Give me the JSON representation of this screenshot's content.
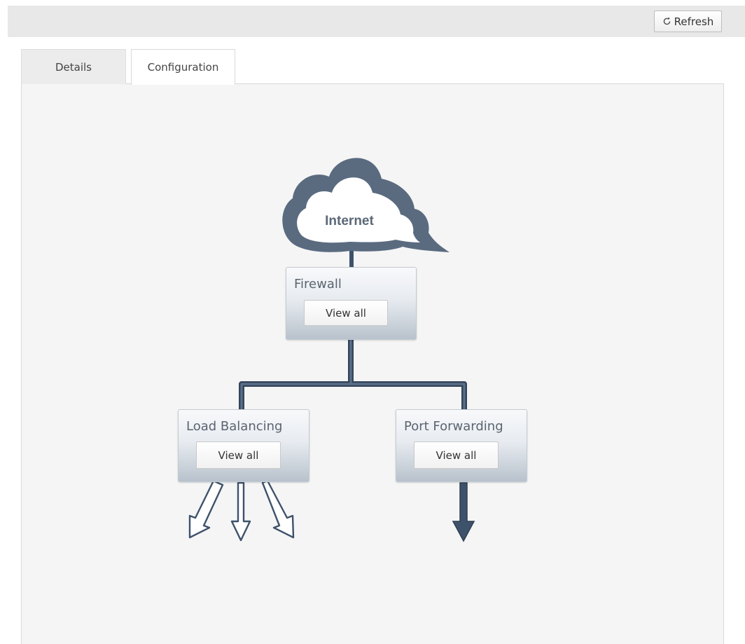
{
  "toolbar": {
    "refresh_label": "Refresh"
  },
  "tabs": [
    {
      "label": "Details",
      "active": false
    },
    {
      "label": "Configuration",
      "active": true
    }
  ],
  "diagram": {
    "internet_label": "Internet",
    "nodes": {
      "firewall": {
        "title": "Firewall",
        "button": "View all"
      },
      "load_balancing": {
        "title": "Load Balancing",
        "button": "View all"
      },
      "port_forwarding": {
        "title": "Port Forwarding",
        "button": "View all"
      }
    }
  },
  "colors": {
    "line": "#3e526b",
    "cloud": "#5a6b80"
  }
}
